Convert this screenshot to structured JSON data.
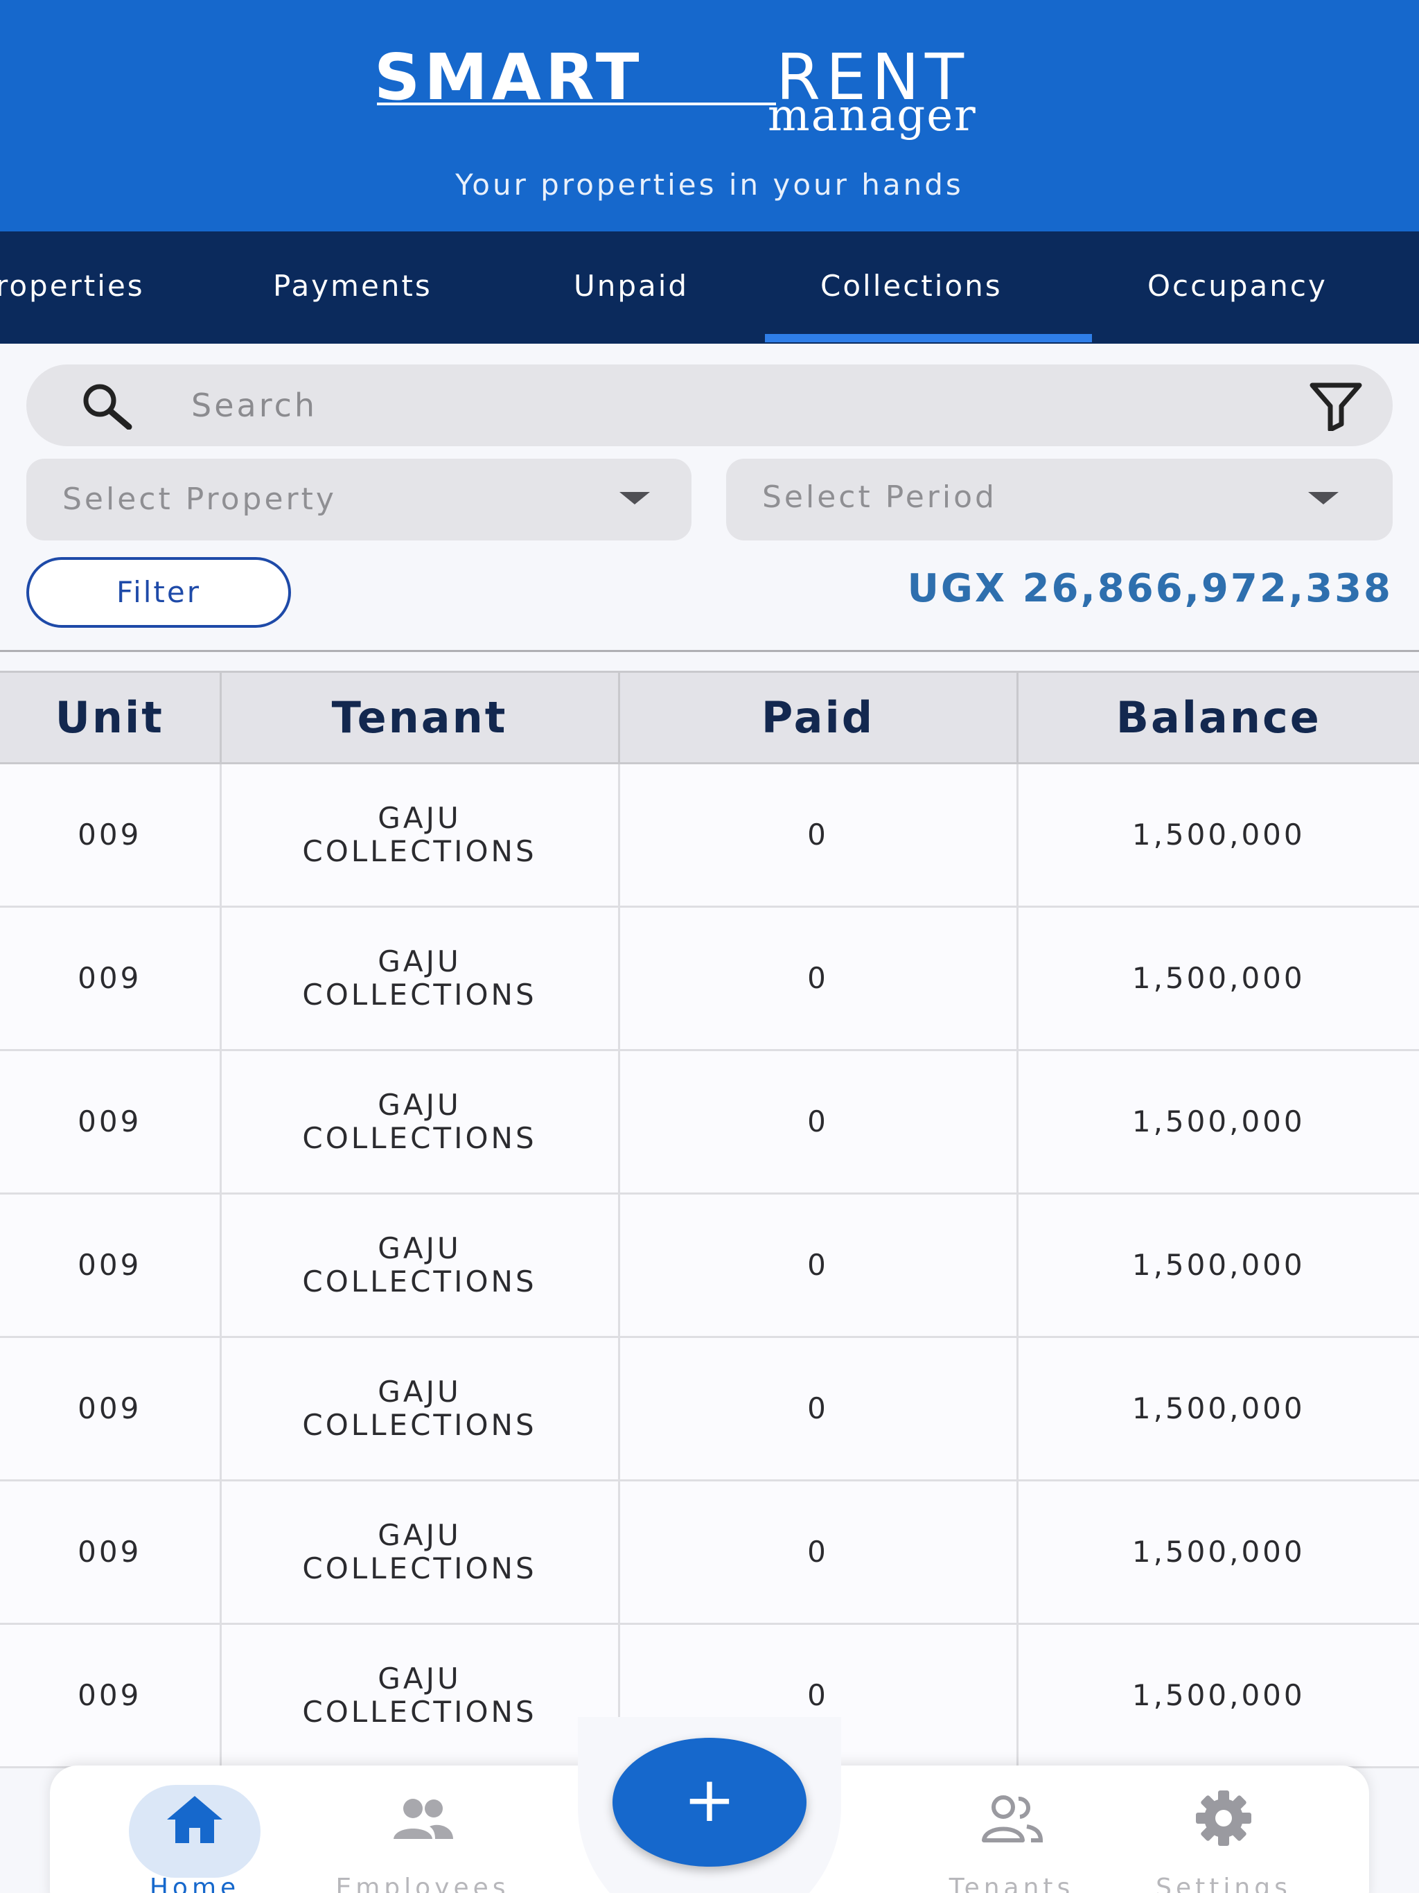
{
  "header": {
    "logo_smart": "SMART",
    "logo_rent": "RENT",
    "logo_manager": "manager",
    "tagline": "Your properties in your hands"
  },
  "tabs": [
    {
      "label": "roperties"
    },
    {
      "label": "Payments"
    },
    {
      "label": "Unpaid"
    },
    {
      "label": "Collections",
      "active": true
    },
    {
      "label": "Occupancy"
    }
  ],
  "search": {
    "placeholder": "Search"
  },
  "filters": {
    "property": "Select Property",
    "period": "Select Period",
    "filter_button": "Filter",
    "total": "UGX 26,866,972,338"
  },
  "table": {
    "headers": [
      "Unit",
      "Tenant",
      "Paid",
      "Balance"
    ],
    "rows": [
      {
        "unit": "009",
        "tenant_line1": "GAJU",
        "tenant_line2": "COLLECTIONS",
        "paid": "0",
        "balance": "1,500,000"
      },
      {
        "unit": "009",
        "tenant_line1": "GAJU",
        "tenant_line2": "COLLECTIONS",
        "paid": "0",
        "balance": "1,500,000"
      },
      {
        "unit": "009",
        "tenant_line1": "GAJU",
        "tenant_line2": "COLLECTIONS",
        "paid": "0",
        "balance": "1,500,000"
      },
      {
        "unit": "009",
        "tenant_line1": "GAJU",
        "tenant_line2": "COLLECTIONS",
        "paid": "0",
        "balance": "1,500,000"
      },
      {
        "unit": "009",
        "tenant_line1": "GAJU",
        "tenant_line2": "COLLECTIONS",
        "paid": "0",
        "balance": "1,500,000"
      },
      {
        "unit": "009",
        "tenant_line1": "GAJU",
        "tenant_line2": "COLLECTIONS",
        "paid": "0",
        "balance": "1,500,000"
      },
      {
        "unit": "009",
        "tenant_line1": "GAJU",
        "tenant_line2": "COLLECTIONS",
        "paid": "0",
        "balance": "1,500,000"
      }
    ]
  },
  "bottom_nav": {
    "fab_label": "+",
    "items": [
      {
        "label": "Home",
        "icon": "home-icon",
        "active": true
      },
      {
        "label": "Employees",
        "icon": "employees-icon"
      },
      {
        "label": "Tenants",
        "icon": "tenants-icon"
      },
      {
        "label": "Settings",
        "icon": "gear-icon"
      }
    ]
  },
  "colors": {
    "header_blue": "#1668cc",
    "tab_bar_navy": "#0b2a5c",
    "tab_indicator": "#2f7ee8",
    "total_text": "#2e6fae"
  }
}
